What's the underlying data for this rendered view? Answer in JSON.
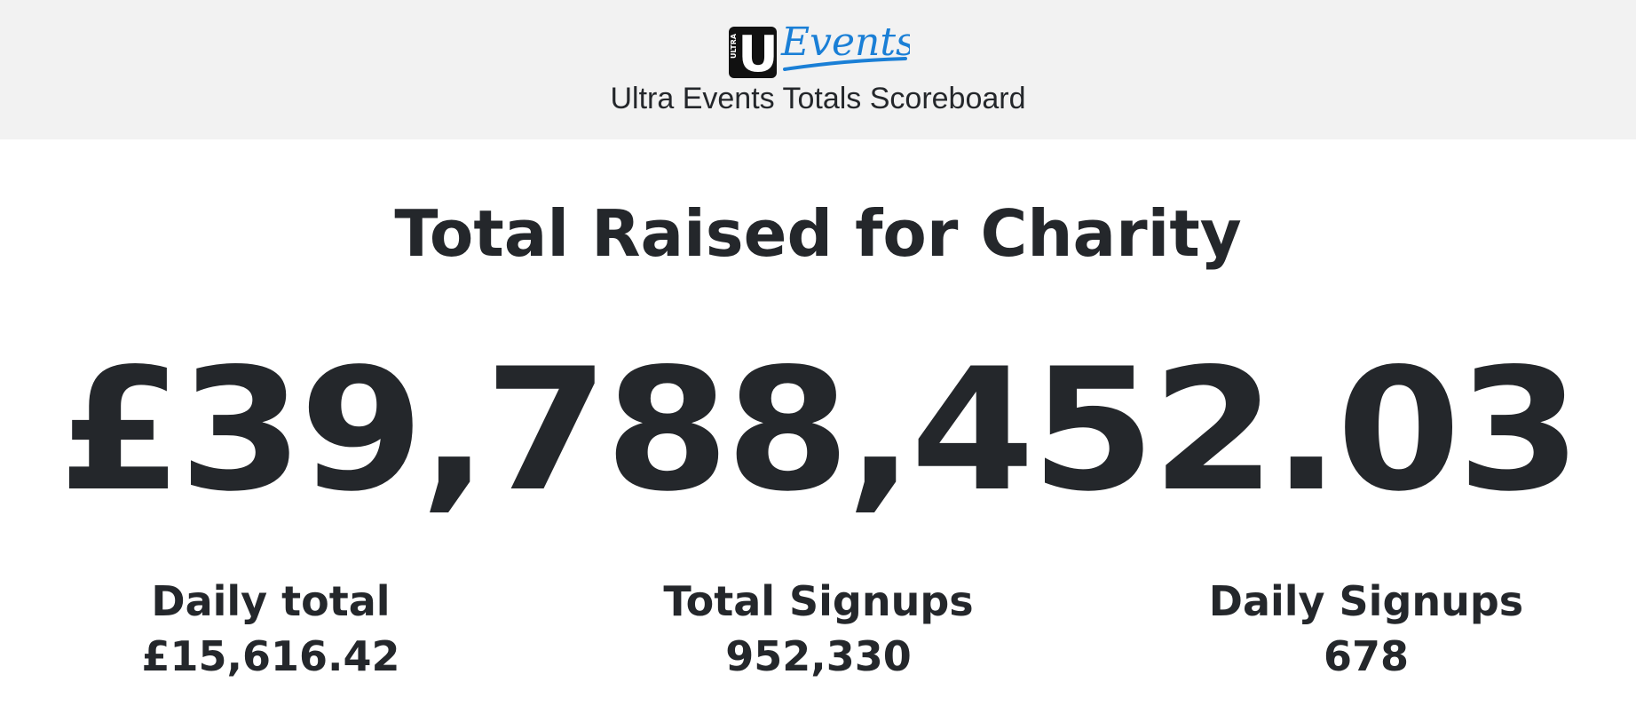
{
  "header": {
    "logo": {
      "badge_letter": "U",
      "badge_small_text": "ULTRA",
      "wordmark": "Events",
      "badge_color": "#111111",
      "wordmark_color": "#1a7fd6"
    },
    "subtitle": "Ultra Events Totals Scoreboard",
    "background": "#f2f2f2"
  },
  "main": {
    "heading": "Total Raised for Charity",
    "total_raised": "£39,788,452.03"
  },
  "stats": [
    {
      "label": "Daily total",
      "value": "£15,616.42"
    },
    {
      "label": "Total Signups",
      "value": "952,330"
    },
    {
      "label": "Daily Signups",
      "value": "678"
    }
  ],
  "colors": {
    "text": "#24272b",
    "page_background": "#ffffff"
  }
}
